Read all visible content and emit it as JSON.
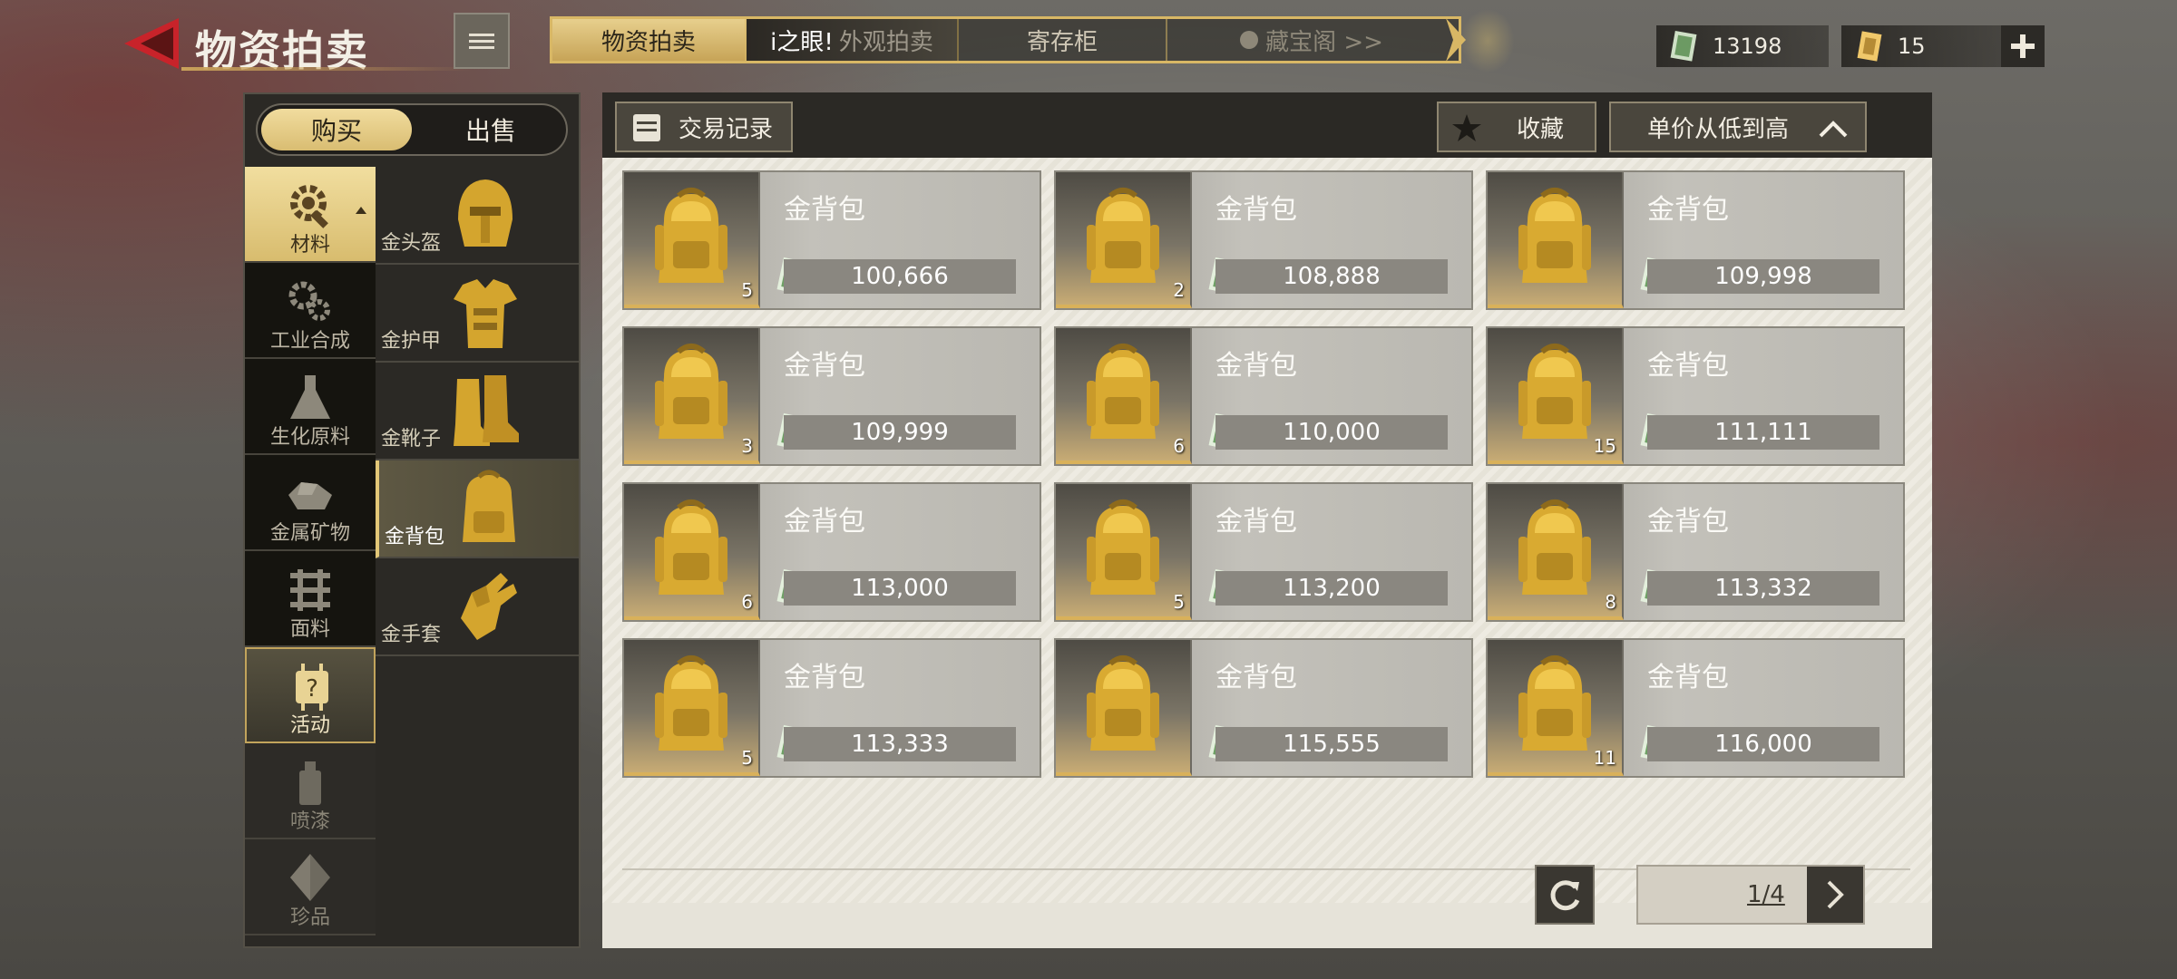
{
  "header": {
    "title": "物资拍卖",
    "tabs": [
      {
        "label": "物资拍卖",
        "active": true
      },
      {
        "label_strong": "i之眼!",
        "label": "外观拍卖",
        "promo": true
      },
      {
        "label": "寄存柜"
      },
      {
        "label": "藏宝阁 >>",
        "dimmed": true
      }
    ],
    "currency_cash": "13198",
    "currency_ticket": "15"
  },
  "sidebar": {
    "buy_label": "购买",
    "sell_label": "出售",
    "categories": [
      {
        "label": "材料",
        "icon": "gear-wrench-icon",
        "state": "active"
      },
      {
        "label": "工业合成",
        "icon": "gears-icon"
      },
      {
        "label": "生化原料",
        "icon": "flask-icon"
      },
      {
        "label": "金属矿物",
        "icon": "ore-icon"
      },
      {
        "label": "面料",
        "icon": "fabric-icon"
      },
      {
        "label": "活动",
        "icon": "mystery-chip-icon",
        "state": "highlight"
      },
      {
        "label": "喷漆",
        "icon": "spray-can-icon",
        "state": "faded"
      },
      {
        "label": "珍品",
        "icon": "gem-icon",
        "state": "faded"
      }
    ],
    "items": [
      {
        "label": "金头盔",
        "icon": "gold-helmet-icon"
      },
      {
        "label": "金护甲",
        "icon": "gold-armor-icon"
      },
      {
        "label": "金靴子",
        "icon": "gold-boots-icon"
      },
      {
        "label": "金背包",
        "icon": "gold-backpack-icon",
        "active": true
      },
      {
        "label": "金手套",
        "icon": "gold-gloves-icon"
      }
    ]
  },
  "toolbar": {
    "history_label": "交易记录",
    "favorite_label": "收藏",
    "sort_label": "单价从低到高"
  },
  "listings": [
    {
      "name": "金背包",
      "qty": "5",
      "price": "100,666"
    },
    {
      "name": "金背包",
      "qty": "2",
      "price": "108,888"
    },
    {
      "name": "金背包",
      "qty": "",
      "price": "109,998"
    },
    {
      "name": "金背包",
      "qty": "3",
      "price": "109,999"
    },
    {
      "name": "金背包",
      "qty": "6",
      "price": "110,000"
    },
    {
      "name": "金背包",
      "qty": "15",
      "price": "111,111"
    },
    {
      "name": "金背包",
      "qty": "6",
      "price": "113,000"
    },
    {
      "name": "金背包",
      "qty": "5",
      "price": "113,200"
    },
    {
      "name": "金背包",
      "qty": "8",
      "price": "113,332"
    },
    {
      "name": "金背包",
      "qty": "5",
      "price": "113,333"
    },
    {
      "name": "金背包",
      "qty": "",
      "price": "115,555"
    },
    {
      "name": "金背包",
      "qty": "11",
      "price": "116,000"
    }
  ],
  "pagination": {
    "page_text": "1/4"
  },
  "colors": {
    "gold": "#d9bd72",
    "panel_dark": "#2b2925",
    "accent_red": "#c8232a"
  }
}
